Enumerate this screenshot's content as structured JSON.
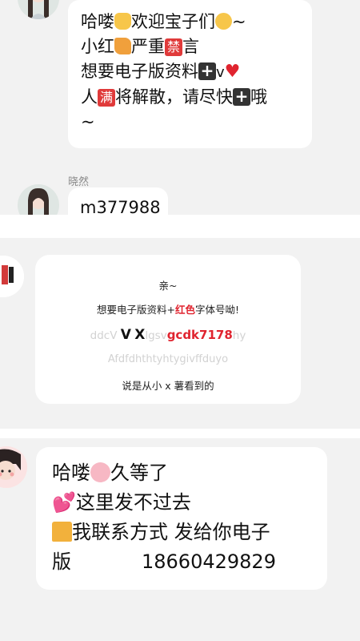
{
  "message1": {
    "line1_text": "哈喽",
    "line1_text2": "欢迎宝子们",
    "line1_tail": "~",
    "line2_a": "小红",
    "line2_b": "严重",
    "line2_ban": "禁",
    "line2_c": "言",
    "line3_a": "想要电子版资料",
    "line3_b": "v",
    "line4_a": "人",
    "line4_full": "满",
    "line4_b": "将解散，请尽快",
    "line4_c": "哦",
    "line5": "~",
    "icons": [
      "wave-hand-emoji",
      "squint-tongue-emoji",
      "book-emoji",
      "ban-badge",
      "plus-sign",
      "red-heart",
      "full-badge",
      "plus-sign"
    ]
  },
  "message2": {
    "sender": "晓然",
    "text": "m377988"
  },
  "card": {
    "greeting": "亲~",
    "line2_a": "想要电子版资料+",
    "line2_red": "红色",
    "line2_b": "字体号呦!",
    "line3_faint_left": "ddcV",
    "line3_v": "V",
    "line3_x": "X",
    "line3_faint_mid": "lgsv",
    "line3_red": "gcdk7178",
    "line3_faint_right": "hy",
    "line4_faint": "Afdfdhthtyhtygivffduyo",
    "line5": "说是从小 x 薯看到的"
  },
  "message3": {
    "line1_a": "哈喽",
    "line1_b": "久等了",
    "line2": "这里发不过去",
    "line3": "我联系方式 发给你电子",
    "line4_a": "版",
    "line4_phone": "18660429829",
    "icons": [
      "pig-face-emoji",
      "two-hearts-emoji",
      "house-emoji"
    ]
  },
  "colors": {
    "background": "#efefef",
    "bubble": "#ffffff",
    "accent_red": "#e0242f"
  }
}
